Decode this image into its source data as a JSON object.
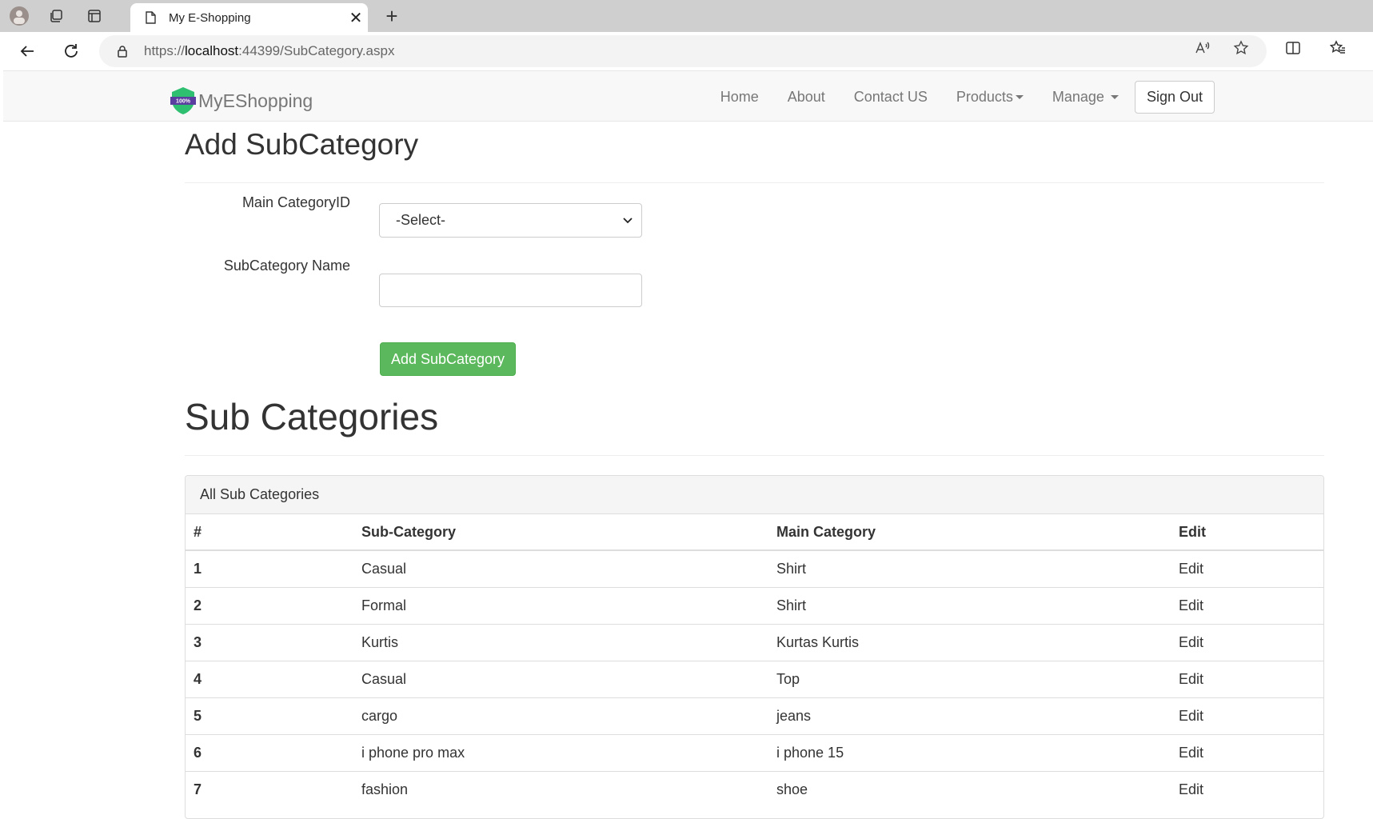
{
  "browser": {
    "tab_title": "My E-Shopping",
    "url_prefix": "https://",
    "url_host": "localhost",
    "url_rest": ":44399/SubCategory.aspx"
  },
  "navbar": {
    "brand": "MyEShopping",
    "links": [
      "Home",
      "About",
      "Contact US"
    ],
    "products": "Products",
    "manage": "Manage",
    "sign_out": "Sign Out"
  },
  "form": {
    "heading": "Add SubCategory",
    "main_category_label": "Main CategoryID",
    "main_category_value": "-Select-",
    "subcategory_label": "SubCategory Name",
    "subcategory_value": "",
    "submit_label": "Add SubCategory"
  },
  "list": {
    "heading": "Sub Categories",
    "panel_title": "All Sub Categories",
    "columns": [
      "#",
      "Sub-Category",
      "Main Category",
      "Edit"
    ],
    "rows": [
      [
        "1",
        "Casual",
        "Shirt",
        "Edit"
      ],
      [
        "2",
        "Formal",
        "Shirt",
        "Edit"
      ],
      [
        "3",
        "Kurtis",
        "Kurtas Kurtis",
        "Edit"
      ],
      [
        "4",
        "Casual",
        "Top",
        "Edit"
      ],
      [
        "5",
        "cargo",
        "jeans",
        "Edit"
      ],
      [
        "6",
        "i phone pro max",
        "i phone 15",
        "Edit"
      ],
      [
        "7",
        "fashion",
        "shoe",
        "Edit"
      ]
    ]
  },
  "colors": {
    "success": "#5cb85c",
    "navbar_bg": "#f8f8f8"
  }
}
